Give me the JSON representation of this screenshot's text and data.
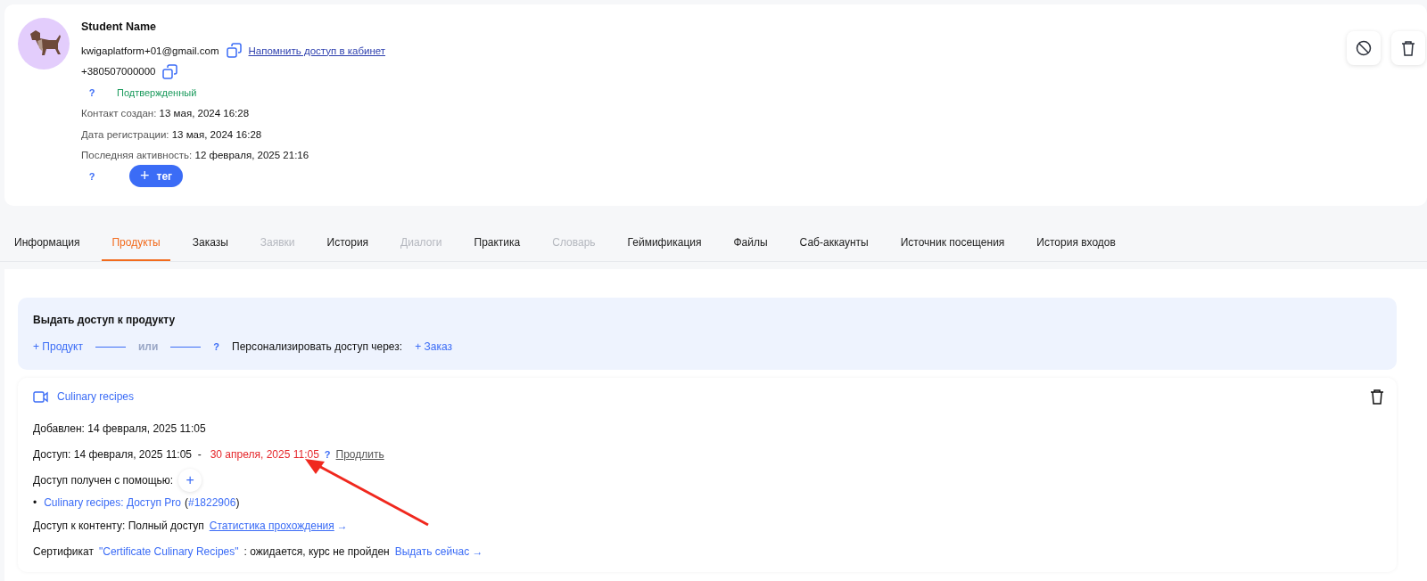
{
  "profile": {
    "name": "Student Name",
    "email": "kwigaplatform+01@gmail.com",
    "remind_link": "Напомнить доступ в кабинет",
    "phone": "+380507000000",
    "help_mark": "?",
    "status": "Подтвержденный",
    "facts": [
      {
        "label": "Контакт создан:",
        "value": "13 мая, 2024 16:28"
      },
      {
        "label": "Дата регистрации:",
        "value": "13 мая, 2024 16:28"
      },
      {
        "label": "Последняя активность:",
        "value": "12 февраля, 2025 21:16"
      }
    ],
    "tag_help_mark": "?",
    "tag_button": {
      "icon": "+",
      "label": "тег"
    }
  },
  "tabs": [
    {
      "label": "Информация",
      "selected": false,
      "disabled": false
    },
    {
      "label": "Продукты",
      "selected": true,
      "disabled": false
    },
    {
      "label": "Заказы",
      "selected": false,
      "disabled": false
    },
    {
      "label": "Заявки",
      "selected": false,
      "disabled": true
    },
    {
      "label": "История",
      "selected": false,
      "disabled": false
    },
    {
      "label": "Диалоги",
      "selected": false,
      "disabled": true
    },
    {
      "label": "Практика",
      "selected": false,
      "disabled": false
    },
    {
      "label": "Словарь",
      "selected": false,
      "disabled": true
    },
    {
      "label": "Геймификация",
      "selected": false,
      "disabled": false
    },
    {
      "label": "Файлы",
      "selected": false,
      "disabled": false
    },
    {
      "label": "Саб-аккаунты",
      "selected": false,
      "disabled": false
    },
    {
      "label": "Источник посещения",
      "selected": false,
      "disabled": false
    },
    {
      "label": "История входов",
      "selected": false,
      "disabled": false
    }
  ],
  "grant": {
    "title": "Выдать доступ к продукту",
    "product_link": "+ Продукт",
    "or": "или",
    "help_mark": "?",
    "personalize": "Персонализировать доступ через:",
    "order_link": "+ Заказ"
  },
  "product": {
    "title": "Culinary recipes",
    "added_label": "Добавлен:",
    "added": "14 февраля, 2025 11:05",
    "access_label": "Доступ:",
    "access_from": "14 февраля, 2025 11:05",
    "dash": "-",
    "access_to": "30 апреля, 2025 11:05",
    "help_mark": "?",
    "extend": "Продлить",
    "via_label": "Доступ получен с помощью:",
    "add_icon": "+",
    "via_items": [
      {
        "bullet": "•",
        "link": "Culinary recipes: Доступ Pro",
        "order_open": "(",
        "order": "#1822906",
        "order_close": ")"
      }
    ],
    "content_label": "Доступ к контенту:",
    "content": "Полный доступ",
    "stats_link": "Статистика прохождения",
    "arrow": "→",
    "cert_label": "Сертификат",
    "cert_name": "\"Certificate Culinary Recipes\"",
    "cert_status": ": ожидается, курс не пройден",
    "cert_link": "Выдать сейчас →"
  }
}
